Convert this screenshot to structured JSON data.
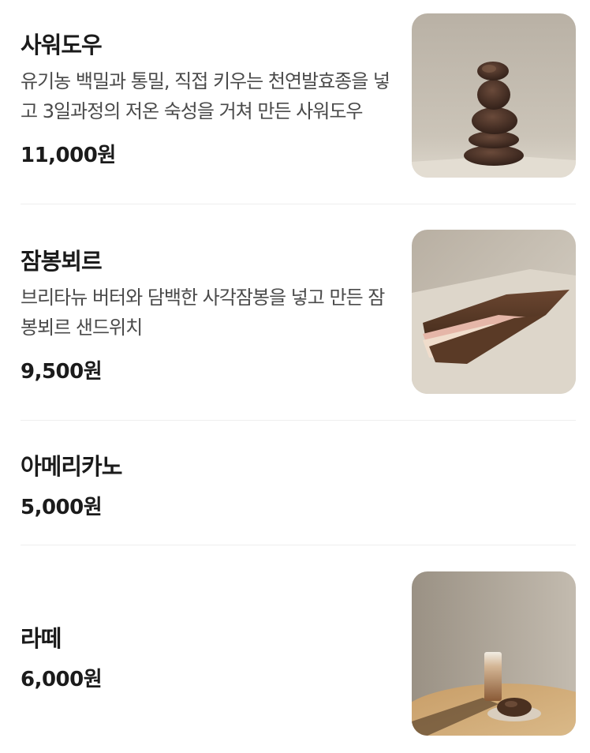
{
  "menu": {
    "items": [
      {
        "name": "사워도우",
        "description": "유기농 백밀과 통밀, 직접 키우는 천연발효종을 넣고 3일과정의 저온 숙성을 거쳐 만든 사워도우",
        "price": "11,000원",
        "photo": "sourdough-stack-photo"
      },
      {
        "name": "잠봉뵈르",
        "description": "브리타뉴 버터와 담백한 사각잠봉을 넣고 만든 잠봉뵈르 샌드위치",
        "price": "9,500원",
        "photo": "jambon-beurre-sandwich-photo"
      },
      {
        "name": "아메리카노",
        "price": "5,000원"
      },
      {
        "name": "라떼",
        "price": "6,000원",
        "photo": "latte-with-cookie-photo"
      }
    ]
  }
}
